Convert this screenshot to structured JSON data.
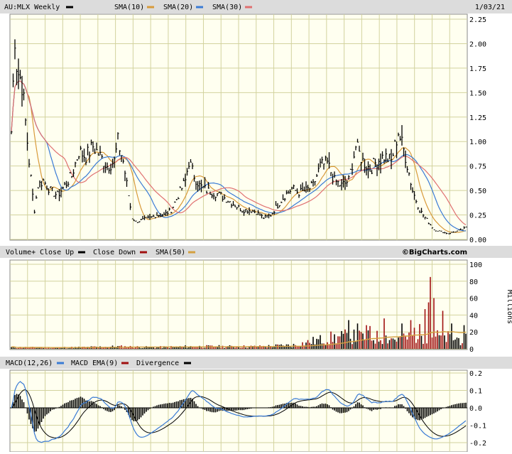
{
  "header": {
    "symbol": "AU:MLX Weekly",
    "legend": [
      {
        "label": "SMA(10)",
        "color": "#d89a3a"
      },
      {
        "label": "SMA(20)",
        "color": "#d89a3a"
      },
      {
        "label": "SMA(30)",
        "color": "#3a7bd5"
      },
      {
        "label": "",
        "color": "#e07070"
      }
    ],
    "date": "1/03/21"
  },
  "volume_header": {
    "label": "Volume+",
    "close_up": "Close Up",
    "close_down": "Close Down",
    "sma": "SMA(50)",
    "credit": "©BigCharts.com",
    "units": "Millions"
  },
  "macd_header": {
    "macd": "MACD(12,26)",
    "ema": "MACD EMA(9)",
    "divergence": "Divergence"
  },
  "colors": {
    "plot_bg": "#fffff0",
    "grid": "#d2d29e",
    "header_bg": "#dcdcdc",
    "price": "#000000",
    "sma10": "#d89a3a",
    "sma20": "#3a7bd5",
    "sma30": "#e07070",
    "vol_up": "#000000",
    "vol_down": "#a01010",
    "vol_sma": "#d4a040",
    "macd": "#3a7bd5",
    "ema": "#000000",
    "divergence": "#000000"
  },
  "chart_data": [
    {
      "type": "line",
      "title": "AU:MLX Weekly",
      "ylim": [
        0,
        2.25
      ],
      "yticks": [
        "2.25",
        "2.00",
        "1.75",
        "1.50",
        "1.25",
        "1.00",
        "0.75",
        "0.50",
        "0.25",
        "0.00"
      ],
      "ytick_values": [
        2.25,
        2.0,
        1.75,
        1.5,
        1.25,
        1.0,
        0.75,
        0.5,
        0.25,
        0.0
      ],
      "price_anchors": [
        [
          0,
          1.1
        ],
        [
          1,
          1.6
        ],
        [
          2,
          2.1
        ],
        [
          3,
          1.8
        ],
        [
          4,
          1.7
        ],
        [
          6,
          1.6
        ],
        [
          8,
          1.2
        ],
        [
          10,
          0.8
        ],
        [
          12,
          0.45
        ],
        [
          13,
          0.3
        ],
        [
          15,
          0.55
        ],
        [
          18,
          0.6
        ],
        [
          22,
          0.5
        ],
        [
          26,
          0.45
        ],
        [
          30,
          0.55
        ],
        [
          34,
          0.65
        ],
        [
          38,
          0.9
        ],
        [
          42,
          0.85
        ],
        [
          46,
          0.95
        ],
        [
          50,
          0.85
        ],
        [
          54,
          0.75
        ],
        [
          58,
          0.8
        ],
        [
          60,
          1.0
        ],
        [
          63,
          0.8
        ],
        [
          66,
          0.45
        ],
        [
          68,
          0.22
        ],
        [
          70,
          0.18
        ],
        [
          74,
          0.2
        ],
        [
          78,
          0.22
        ],
        [
          82,
          0.25
        ],
        [
          86,
          0.25
        ],
        [
          90,
          0.3
        ],
        [
          94,
          0.45
        ],
        [
          98,
          0.6
        ],
        [
          100,
          0.8
        ],
        [
          103,
          0.65
        ],
        [
          106,
          0.55
        ],
        [
          110,
          0.5
        ],
        [
          114,
          0.48
        ],
        [
          118,
          0.45
        ],
        [
          122,
          0.4
        ],
        [
          126,
          0.35
        ],
        [
          130,
          0.3
        ],
        [
          134,
          0.3
        ],
        [
          138,
          0.28
        ],
        [
          142,
          0.22
        ],
        [
          146,
          0.25
        ],
        [
          150,
          0.35
        ],
        [
          154,
          0.45
        ],
        [
          158,
          0.52
        ],
        [
          162,
          0.48
        ],
        [
          166,
          0.5
        ],
        [
          170,
          0.55
        ],
        [
          174,
          0.75
        ],
        [
          178,
          0.78
        ],
        [
          182,
          0.6
        ],
        [
          186,
          0.55
        ],
        [
          190,
          0.6
        ],
        [
          194,
          0.95
        ],
        [
          198,
          0.8
        ],
        [
          202,
          0.72
        ],
        [
          206,
          0.8
        ],
        [
          210,
          0.85
        ],
        [
          214,
          0.8
        ],
        [
          218,
          1.1
        ],
        [
          222,
          0.85
        ],
        [
          226,
          0.5
        ],
        [
          230,
          0.3
        ],
        [
          234,
          0.2
        ],
        [
          238,
          0.1
        ],
        [
          242,
          0.08
        ],
        [
          246,
          0.06
        ],
        [
          250,
          0.08
        ],
        [
          254,
          0.1
        ],
        [
          256,
          0.12
        ]
      ],
      "seed": 7
    },
    {
      "type": "bar",
      "title": "Volume",
      "ylim": [
        0,
        100
      ],
      "yticks": [
        "100",
        "80",
        "60",
        "40",
        "20",
        "0"
      ],
      "ytick_values": [
        100,
        80,
        60,
        40,
        20,
        0
      ],
      "volume_anchors": [
        [
          0,
          2
        ],
        [
          20,
          1.5
        ],
        [
          40,
          2
        ],
        [
          60,
          3
        ],
        [
          80,
          2
        ],
        [
          100,
          3
        ],
        [
          120,
          3
        ],
        [
          140,
          3
        ],
        [
          160,
          5
        ],
        [
          170,
          10
        ],
        [
          180,
          14
        ],
        [
          190,
          16
        ],
        [
          200,
          15
        ],
        [
          210,
          15
        ],
        [
          220,
          12
        ],
        [
          230,
          20
        ],
        [
          240,
          16
        ],
        [
          256,
          12
        ]
      ],
      "volume_spikes": [
        [
          190,
          34
        ],
        [
          195,
          30
        ],
        [
          200,
          28
        ],
        [
          202,
          27
        ],
        [
          210,
          36
        ],
        [
          220,
          30
        ],
        [
          225,
          34
        ],
        [
          227,
          25
        ],
        [
          233,
          47
        ],
        [
          235,
          55
        ],
        [
          236,
          85
        ],
        [
          238,
          60
        ],
        [
          243,
          45
        ],
        [
          248,
          30
        ],
        [
          255,
          28
        ]
      ],
      "seed": 11
    },
    {
      "type": "line",
      "title": "MACD",
      "ylim": [
        -0.25,
        0.2
      ],
      "yticks": [
        "0.2",
        "0.1",
        "0.0",
        "-0.1",
        "-0.2"
      ],
      "ytick_values": [
        0.2,
        0.1,
        0.0,
        -0.1,
        -0.2
      ]
    }
  ]
}
